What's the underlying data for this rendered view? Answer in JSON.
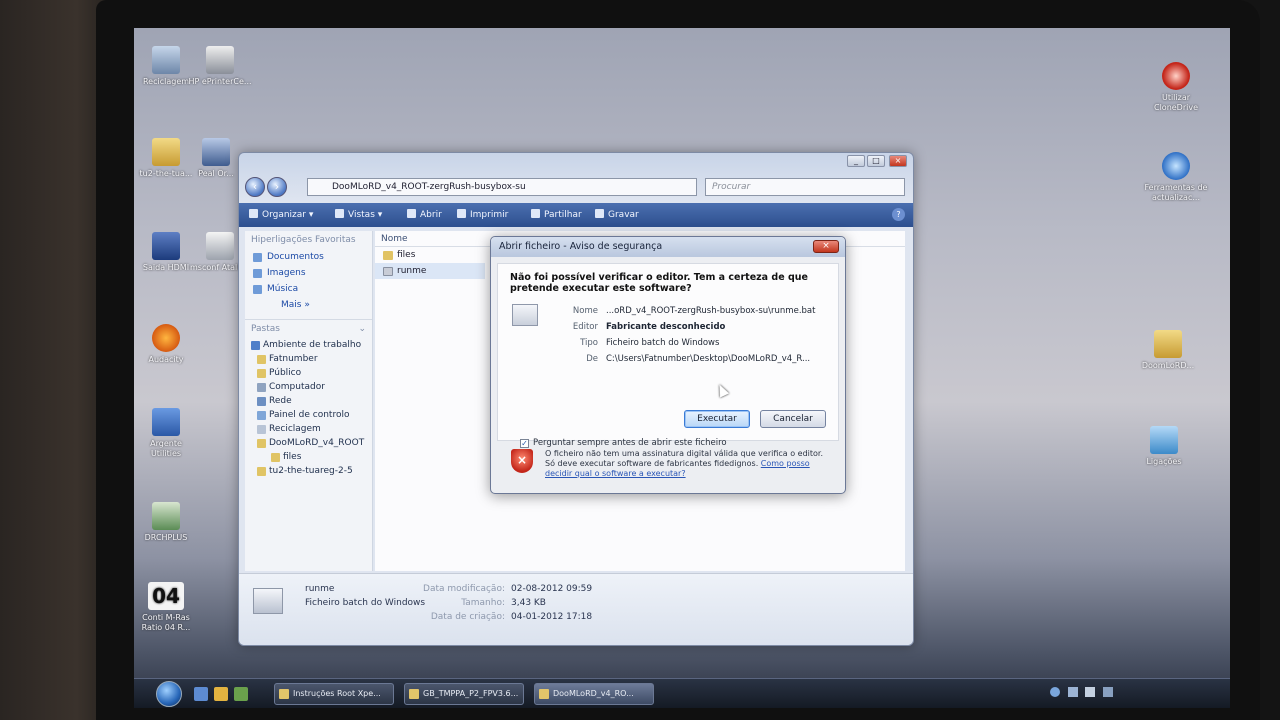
{
  "desktop": {
    "icons": [
      {
        "label": "Reciclagem"
      },
      {
        "label": "HP ePrinterCe..."
      },
      {
        "label": "tu2-the-tua..."
      },
      {
        "label": "Peal Or..."
      },
      {
        "label": "Saida HDMI"
      },
      {
        "label": "msconf Atalh..."
      },
      {
        "label": "Audacity"
      },
      {
        "label": "Argente Utilities"
      },
      {
        "label": "DRCHPLUS"
      },
      {
        "label": "Conti M-Ras Ratio 04 R..."
      },
      {
        "label": "Utilizar CloneDrive"
      },
      {
        "label": "Ferramentas de actualizac..."
      },
      {
        "label": "DoomLoRD..."
      },
      {
        "label": "Ligações"
      }
    ],
    "calendar_tile_text": "04"
  },
  "explorer": {
    "address_path": "DooMLoRD_v4_ROOT-zergRush-busybox-su",
    "search_placeholder": "Procurar",
    "toolbar": {
      "organize": "Organizar",
      "views": "Vistas",
      "open": "Abrir",
      "print": "Imprimir",
      "share": "Partilhar",
      "burn": "Gravar"
    },
    "favorites_title": "Hiperligações Favoritas",
    "favorites": [
      "Documentos",
      "Imagens",
      "Música",
      "Mais"
    ],
    "folders_title": "Pastas",
    "folder_tree": [
      "Ambiente de trabalho",
      "Fatnumber",
      "Público",
      "Computador",
      "Rede",
      "Painel de controlo",
      "Reciclagem",
      "DooMLoRD_v4_ROOT",
      "files",
      "tu2-the-tuareg-2-5"
    ],
    "column_name": "Nome",
    "files": [
      "files",
      "runme"
    ],
    "details": {
      "name": "runme",
      "type": "Ficheiro batch do Windows",
      "modified_label": "Data modificação:",
      "modified_value": "02-08-2012 09:59",
      "size_label": "Tamanho:",
      "size_value": "3,43 KB",
      "created_label": "Data de criação:",
      "created_value": "04-01-2012 17:18"
    }
  },
  "dialog": {
    "title": "Abrir ficheiro - Aviso de segurança",
    "question": "Não foi possível verificar o editor. Tem a certeza de que pretende executar este software?",
    "props": [
      {
        "label": "Nome",
        "value": "...oRD_v4_ROOT-zergRush-busybox-su\\runme.bat"
      },
      {
        "label": "Editor",
        "value": "Fabricante desconhecido"
      },
      {
        "label": "Tipo",
        "value": "Ficheiro batch do Windows"
      },
      {
        "label": "De",
        "value": "C:\\Users\\Fatnumber\\Desktop\\DooMLoRD_v4_R..."
      }
    ],
    "run_button": "Executar",
    "cancel_button": "Cancelar",
    "checkbox_label": "Perguntar sempre antes de abrir este ficheiro",
    "checkbox_checked": true,
    "warning_text": "O ficheiro não tem uma assinatura digital válida que verifica o editor. Só deve executar software de fabricantes fidedignos.",
    "warning_link": "Como posso decidir qual o software a executar?"
  },
  "taskbar": {
    "tasks": [
      {
        "label": "Instruções Root Xpe..."
      },
      {
        "label": "GB_TMPPA_P2_FPV3.6..."
      },
      {
        "label": "DooMLoRD_v4_RO..."
      }
    ]
  }
}
